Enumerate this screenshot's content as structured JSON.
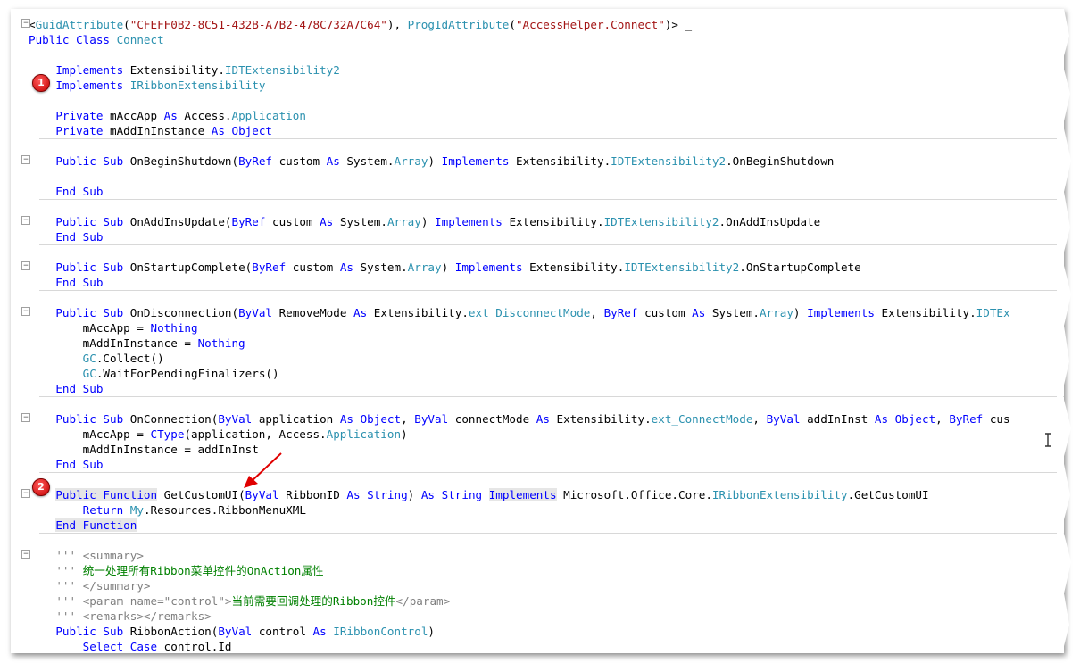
{
  "editor": {
    "lines": [
      {
        "tokens": [
          [
            "p",
            "<"
          ],
          [
            "ty",
            "GuidAttribute"
          ],
          [
            "p",
            "("
          ],
          [
            "str",
            "\"CFEFF0B2-8C51-432B-A7B2-478C732A7C64\""
          ],
          [
            "p",
            "), "
          ],
          [
            "ty",
            "ProgIdAttribute"
          ],
          [
            "p",
            "("
          ],
          [
            "str",
            "\"AccessHelper.Connect\""
          ],
          [
            "p",
            ")> _"
          ]
        ],
        "fold": true
      },
      {
        "tokens": [
          [
            "kw",
            "Public Class "
          ],
          [
            "ty",
            "Connect"
          ]
        ]
      },
      {
        "tokens": []
      },
      {
        "tokens": [
          [
            "p",
            "    "
          ],
          [
            "kw",
            "Implements"
          ],
          [
            "p",
            " Extensibility."
          ],
          [
            "ty",
            "IDTExtensibility2"
          ]
        ]
      },
      {
        "tokens": [
          [
            "p",
            "    "
          ],
          [
            "kw",
            "Implements"
          ],
          [
            "p",
            " "
          ],
          [
            "ty",
            "IRibbonExtensibility"
          ]
        ]
      },
      {
        "tokens": []
      },
      {
        "tokens": [
          [
            "p",
            "    "
          ],
          [
            "kw",
            "Private"
          ],
          [
            "p",
            " mAccApp "
          ],
          [
            "kw",
            "As"
          ],
          [
            "p",
            " Access."
          ],
          [
            "ty",
            "Application"
          ]
        ]
      },
      {
        "tokens": [
          [
            "p",
            "    "
          ],
          [
            "kw",
            "Private"
          ],
          [
            "p",
            " mAddInInstance "
          ],
          [
            "kw",
            "As"
          ],
          [
            "p",
            " "
          ],
          [
            "kw",
            "Object"
          ]
        ],
        "sep": true
      },
      {
        "tokens": []
      },
      {
        "tokens": [
          [
            "p",
            "    "
          ],
          [
            "kw",
            "Public Sub"
          ],
          [
            "p",
            " OnBeginShutdown("
          ],
          [
            "kw",
            "ByRef"
          ],
          [
            "p",
            " custom "
          ],
          [
            "kw",
            "As"
          ],
          [
            "p",
            " System."
          ],
          [
            "ty",
            "Array"
          ],
          [
            "p",
            ") "
          ],
          [
            "kw",
            "Implements"
          ],
          [
            "p",
            " Extensibility."
          ],
          [
            "ty",
            "IDTExtensibility2"
          ],
          [
            "p",
            ".OnBeginShutdown"
          ]
        ],
        "fold": true
      },
      {
        "tokens": []
      },
      {
        "tokens": [
          [
            "p",
            "    "
          ],
          [
            "kw",
            "End Sub"
          ]
        ],
        "sep": true
      },
      {
        "tokens": []
      },
      {
        "tokens": [
          [
            "p",
            "    "
          ],
          [
            "kw",
            "Public Sub"
          ],
          [
            "p",
            " OnAddInsUpdate("
          ],
          [
            "kw",
            "ByRef"
          ],
          [
            "p",
            " custom "
          ],
          [
            "kw",
            "As"
          ],
          [
            "p",
            " System."
          ],
          [
            "ty",
            "Array"
          ],
          [
            "p",
            ") "
          ],
          [
            "kw",
            "Implements"
          ],
          [
            "p",
            " Extensibility."
          ],
          [
            "ty",
            "IDTExtensibility2"
          ],
          [
            "p",
            ".OnAddInsUpdate"
          ]
        ],
        "fold": true
      },
      {
        "tokens": [
          [
            "p",
            "    "
          ],
          [
            "kw",
            "End Sub"
          ]
        ],
        "sep": true
      },
      {
        "tokens": []
      },
      {
        "tokens": [
          [
            "p",
            "    "
          ],
          [
            "kw",
            "Public Sub"
          ],
          [
            "p",
            " OnStartupComplete("
          ],
          [
            "kw",
            "ByRef"
          ],
          [
            "p",
            " custom "
          ],
          [
            "kw",
            "As"
          ],
          [
            "p",
            " System."
          ],
          [
            "ty",
            "Array"
          ],
          [
            "p",
            ") "
          ],
          [
            "kw",
            "Implements"
          ],
          [
            "p",
            " Extensibility."
          ],
          [
            "ty",
            "IDTExtensibility2"
          ],
          [
            "p",
            ".OnStartupComplete"
          ]
        ],
        "fold": true
      },
      {
        "tokens": [
          [
            "p",
            "    "
          ],
          [
            "kw",
            "End Sub"
          ]
        ],
        "sep": true
      },
      {
        "tokens": []
      },
      {
        "tokens": [
          [
            "p",
            "    "
          ],
          [
            "kw",
            "Public Sub"
          ],
          [
            "p",
            " OnDisconnection("
          ],
          [
            "kw",
            "ByVal"
          ],
          [
            "p",
            " RemoveMode "
          ],
          [
            "kw",
            "As"
          ],
          [
            "p",
            " Extensibility."
          ],
          [
            "ty",
            "ext_DisconnectMode"
          ],
          [
            "p",
            ", "
          ],
          [
            "kw",
            "ByRef"
          ],
          [
            "p",
            " custom "
          ],
          [
            "kw",
            "As"
          ],
          [
            "p",
            " System."
          ],
          [
            "ty",
            "Array"
          ],
          [
            "p",
            ") "
          ],
          [
            "kw",
            "Implements"
          ],
          [
            "p",
            " Extensibility."
          ],
          [
            "ty",
            "IDTEx"
          ]
        ],
        "fold": true
      },
      {
        "tokens": [
          [
            "p",
            "        mAccApp = "
          ],
          [
            "kw",
            "Nothing"
          ]
        ]
      },
      {
        "tokens": [
          [
            "p",
            "        mAddInInstance = "
          ],
          [
            "kw",
            "Nothing"
          ]
        ]
      },
      {
        "tokens": [
          [
            "p",
            "        "
          ],
          [
            "ty",
            "GC"
          ],
          [
            "p",
            ".Collect()"
          ]
        ]
      },
      {
        "tokens": [
          [
            "p",
            "        "
          ],
          [
            "ty",
            "GC"
          ],
          [
            "p",
            ".WaitForPendingFinalizers()"
          ]
        ]
      },
      {
        "tokens": [
          [
            "p",
            "    "
          ],
          [
            "kw",
            "End Sub"
          ]
        ],
        "sep": true
      },
      {
        "tokens": []
      },
      {
        "tokens": [
          [
            "p",
            "    "
          ],
          [
            "kw",
            "Public Sub"
          ],
          [
            "p",
            " OnConnection("
          ],
          [
            "kw",
            "ByVal"
          ],
          [
            "p",
            " application "
          ],
          [
            "kw",
            "As"
          ],
          [
            "p",
            " "
          ],
          [
            "kw",
            "Object"
          ],
          [
            "p",
            ", "
          ],
          [
            "kw",
            "ByVal"
          ],
          [
            "p",
            " connectMode "
          ],
          [
            "kw",
            "As"
          ],
          [
            "p",
            " Extensibility."
          ],
          [
            "ty",
            "ext_ConnectMode"
          ],
          [
            "p",
            ", "
          ],
          [
            "kw",
            "ByVal"
          ],
          [
            "p",
            " addInInst "
          ],
          [
            "kw",
            "As"
          ],
          [
            "p",
            " "
          ],
          [
            "kw",
            "Object"
          ],
          [
            "p",
            ", "
          ],
          [
            "kw",
            "ByRef"
          ],
          [
            "p",
            " cus"
          ]
        ],
        "fold": true
      },
      {
        "tokens": [
          [
            "p",
            "        mAccApp = "
          ],
          [
            "kw",
            "CType"
          ],
          [
            "p",
            "(application, Access."
          ],
          [
            "ty",
            "Application"
          ],
          [
            "p",
            ")"
          ]
        ]
      },
      {
        "tokens": [
          [
            "p",
            "        mAddInInstance = addInInst"
          ]
        ]
      },
      {
        "tokens": [
          [
            "p",
            "    "
          ],
          [
            "kw",
            "End Sub"
          ]
        ],
        "sep": true
      },
      {
        "tokens": []
      },
      {
        "tokens": [
          [
            "p",
            "    "
          ],
          [
            "kwh",
            "Public Function"
          ],
          [
            "p",
            " GetCustomUI("
          ],
          [
            "kw",
            "ByVal"
          ],
          [
            "p",
            " RibbonID "
          ],
          [
            "kw",
            "As"
          ],
          [
            "p",
            " "
          ],
          [
            "kw",
            "String"
          ],
          [
            "p",
            ") "
          ],
          [
            "kw",
            "As"
          ],
          [
            "p",
            " "
          ],
          [
            "kw",
            "String"
          ],
          [
            "p",
            " "
          ],
          [
            "kwh",
            "Implements"
          ],
          [
            "p",
            " Microsoft.Office.Core."
          ],
          [
            "ty",
            "IRibbonExtensibility"
          ],
          [
            "p",
            ".GetCustomUI"
          ]
        ],
        "fold": true
      },
      {
        "tokens": [
          [
            "p",
            "        "
          ],
          [
            "kw",
            "Return"
          ],
          [
            "p",
            " "
          ],
          [
            "ty",
            "My"
          ],
          [
            "p",
            ".Resources.RibbonMenuXML"
          ]
        ]
      },
      {
        "tokens": [
          [
            "p",
            "    "
          ],
          [
            "kwh",
            "End Function"
          ]
        ],
        "sep": true
      },
      {
        "tokens": []
      },
      {
        "tokens": [
          [
            "p",
            "    "
          ],
          [
            "cmg",
            "'''"
          ],
          [
            "p",
            " "
          ],
          [
            "cmg",
            "<summary>"
          ]
        ],
        "fold": true
      },
      {
        "tokens": [
          [
            "p",
            "    "
          ],
          [
            "cmg",
            "'''"
          ],
          [
            "p",
            " "
          ],
          [
            "cm",
            "统一处理所有Ribbon菜单控件的OnAction属性"
          ]
        ]
      },
      {
        "tokens": [
          [
            "p",
            "    "
          ],
          [
            "cmg",
            "'''"
          ],
          [
            "p",
            " "
          ],
          [
            "cmg",
            "</summary>"
          ]
        ]
      },
      {
        "tokens": [
          [
            "p",
            "    "
          ],
          [
            "cmg",
            "'''"
          ],
          [
            "p",
            " "
          ],
          [
            "cmg",
            "<param name=\"control\">"
          ],
          [
            "cm",
            "当前需要回调处理的Ribbon控件"
          ],
          [
            "cmg",
            "</param>"
          ]
        ]
      },
      {
        "tokens": [
          [
            "p",
            "    "
          ],
          [
            "cmg",
            "'''"
          ],
          [
            "p",
            " "
          ],
          [
            "cmg",
            "<remarks></remarks>"
          ]
        ]
      },
      {
        "tokens": [
          [
            "p",
            "    "
          ],
          [
            "kw",
            "Public Sub"
          ],
          [
            "p",
            " RibbonAction("
          ],
          [
            "kw",
            "ByVal"
          ],
          [
            "p",
            " control "
          ],
          [
            "kw",
            "As"
          ],
          [
            "p",
            " "
          ],
          [
            "ty",
            "IRibbonControl"
          ],
          [
            "p",
            ")"
          ]
        ]
      },
      {
        "tokens": [
          [
            "p",
            "        "
          ],
          [
            "kw",
            "Select Case"
          ],
          [
            "p",
            " control.Id"
          ]
        ]
      }
    ]
  },
  "annotations": [
    {
      "label": "1"
    },
    {
      "label": "2"
    }
  ],
  "colors": {
    "keyword": "#0000ff",
    "type": "#2b91af",
    "string": "#a31515",
    "comment": "#008000",
    "doc_tag": "#808080",
    "highlight": "#e6e6e6",
    "marker": "#e00000"
  }
}
